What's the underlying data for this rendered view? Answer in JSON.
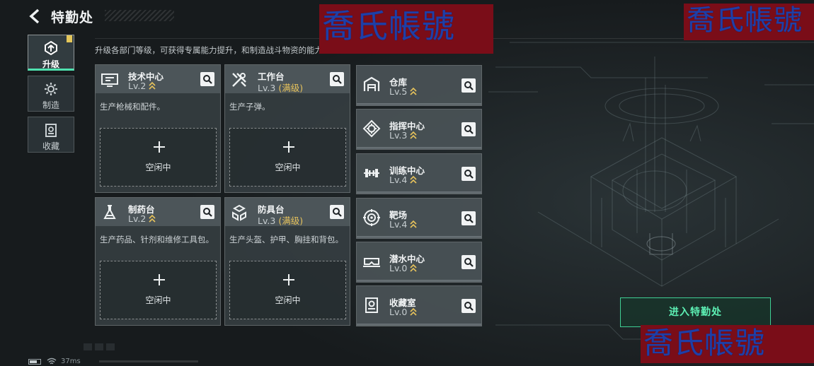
{
  "header": {
    "title": "特勤处",
    "watermark_text": "喬氏帳號"
  },
  "side_tabs": [
    {
      "label": "升级",
      "icon": "upgrade-icon",
      "active": true
    },
    {
      "label": "制造",
      "icon": "gear-icon",
      "active": false
    },
    {
      "label": "收藏",
      "icon": "collection-icon",
      "active": false
    }
  ],
  "description": "升级各部门等级，可获得专属能力提升，和制造战斗物资的能力",
  "big_cards": [
    {
      "name": "技术中心",
      "level": "Lv.2",
      "max_label": "",
      "desc": "生产枪械和配件。",
      "slot_label": "空闲中",
      "icon": "tech-center-icon"
    },
    {
      "name": "工作台",
      "level": "Lv.3",
      "max_label": "(满级)",
      "desc": "生产子弹。",
      "slot_label": "空闲中",
      "icon": "workbench-icon"
    },
    {
      "name": "制药台",
      "level": "Lv.2",
      "max_label": "",
      "desc": "生产药品、针剂和维修工具包。",
      "slot_label": "空闲中",
      "icon": "pharmacy-icon"
    },
    {
      "name": "防具台",
      "level": "Lv.3",
      "max_label": "(满级)",
      "desc": "生产头盔、护甲、胸挂和背包。",
      "slot_label": "空闲中",
      "icon": "armor-bench-icon"
    }
  ],
  "small_cards": [
    {
      "name": "仓库",
      "level": "Lv.5",
      "icon": "warehouse-icon"
    },
    {
      "name": "指挥中心",
      "level": "Lv.3",
      "icon": "command-center-icon"
    },
    {
      "name": "训练中心",
      "level": "Lv.4",
      "icon": "dumbbell-icon"
    },
    {
      "name": "靶场",
      "level": "Lv.4",
      "icon": "target-icon"
    },
    {
      "name": "潜水中心",
      "level": "Lv.0",
      "icon": "diving-mask-icon"
    },
    {
      "name": "收藏室",
      "level": "Lv.0",
      "icon": "collection-room-icon"
    }
  ],
  "enter_button": "进入特勤处",
  "status": {
    "ping": "37ms"
  },
  "colors": {
    "accent": "#4fe3b0",
    "max_level": "#e7c35c",
    "level_arrow": "#e7c35c",
    "watermark_bg": "#7a0d18",
    "watermark_text": "#1e3fa8"
  }
}
